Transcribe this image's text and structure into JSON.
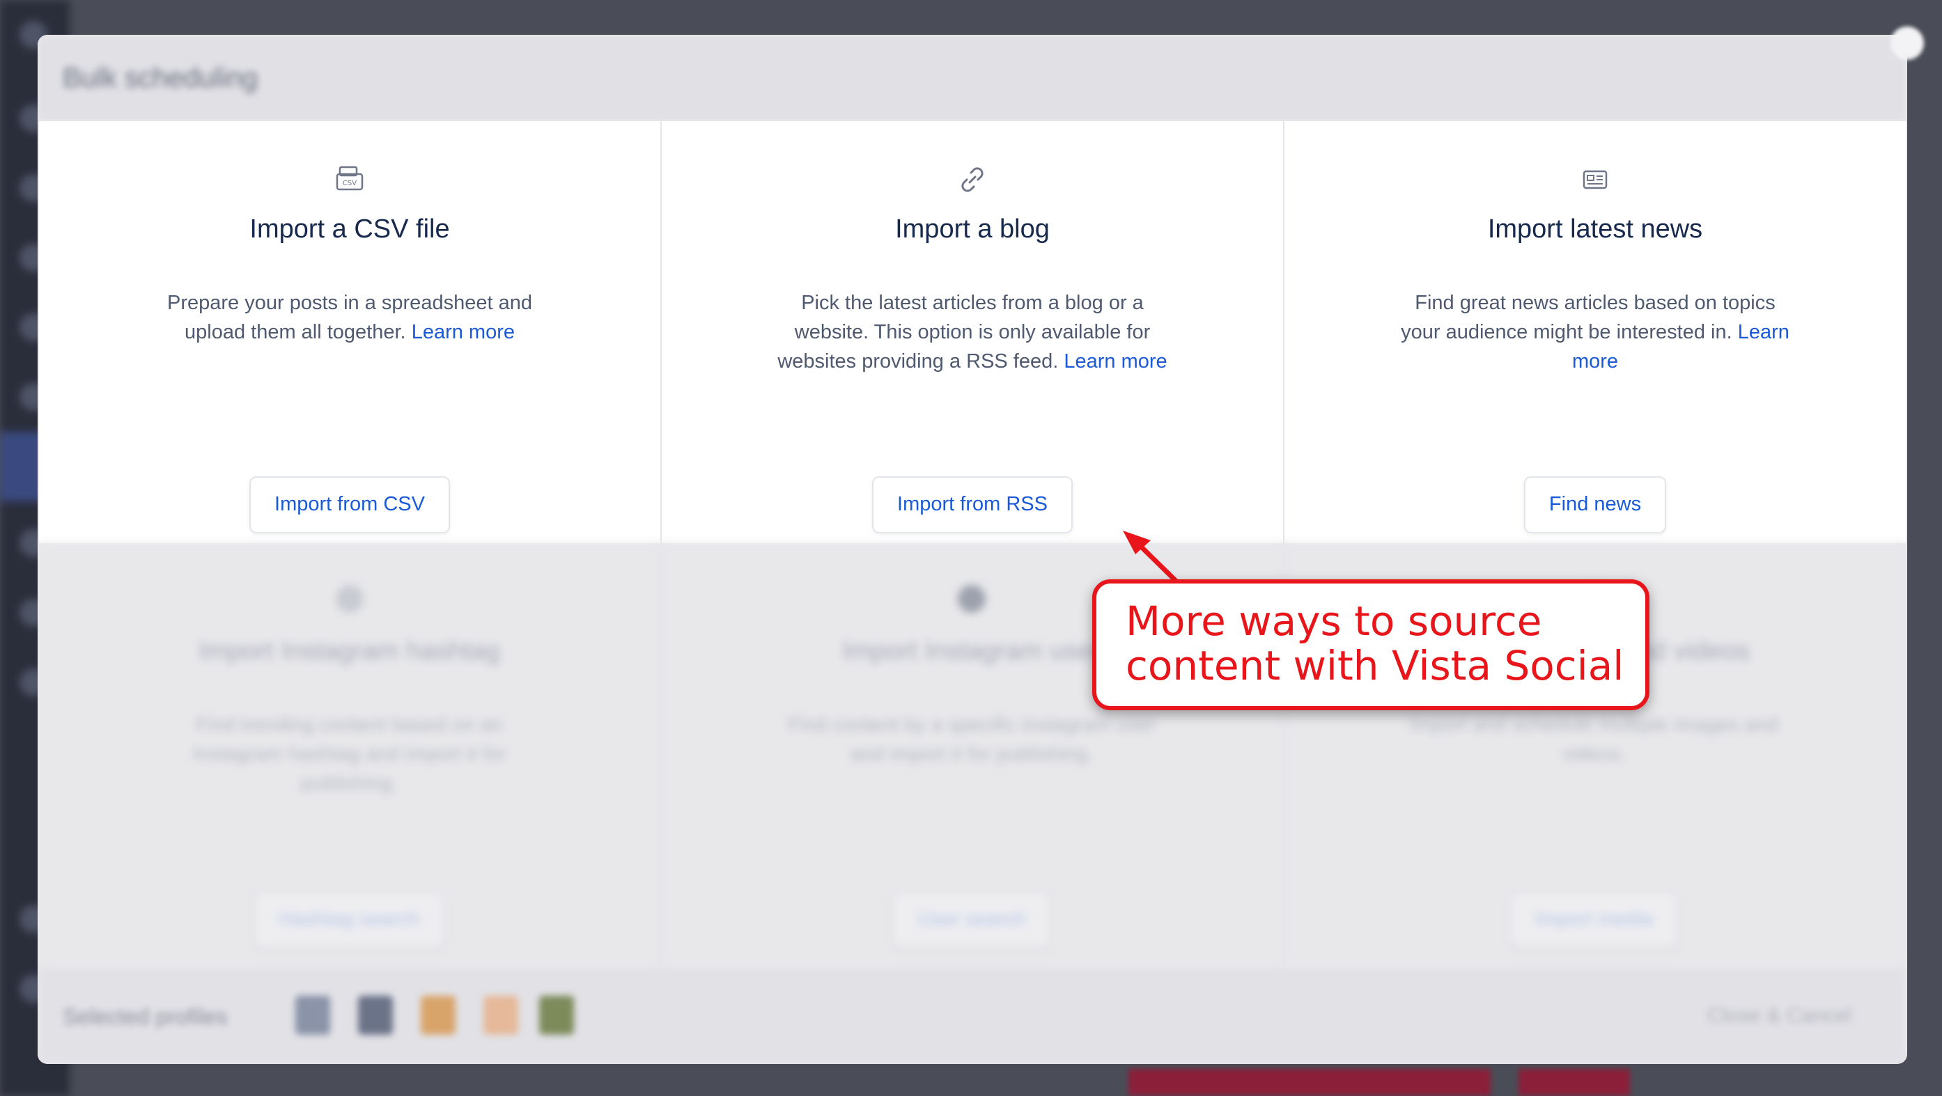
{
  "modal": {
    "title": "Bulk scheduling",
    "cards_top": [
      {
        "icon": "csv-file-icon",
        "title": "Import a CSV file",
        "description": "Prepare your posts in a spreadsheet and upload them all together.",
        "link": "Learn more",
        "button": "Import from CSV"
      },
      {
        "icon": "link-icon",
        "title": "Import a blog",
        "description": "Pick the latest articles from a blog or a website. This option is only available for websites providing a RSS feed.",
        "link": "Learn more",
        "button": "Import from RSS"
      },
      {
        "icon": "newspaper-icon",
        "title": "Import latest news",
        "description": "Find great news articles based on topics your audience might be interested in.",
        "link": "Learn more",
        "button": "Find news"
      }
    ],
    "cards_bottom": [
      {
        "title": "Import Instagram hashtag",
        "description": "Find trending content based on an Instagram hashtag and import it for publishing.",
        "button": "Hashtag search"
      },
      {
        "title": "Import Instagram user",
        "description": "Find content by a specific Instagram user and import it for publishing.",
        "button": "User search"
      },
      {
        "title": "Upload images and videos",
        "description": "Import and schedule multiple images and videos.",
        "button": "Import media"
      }
    ],
    "footer": {
      "selected_profiles_label": "Selected profiles",
      "close_button": "Close & Cancel"
    }
  },
  "callout": {
    "text": "More ways to source content with Vista Social",
    "color": "#e8161b"
  },
  "colors": {
    "link": "#1a5ad8",
    "title": "#17294d"
  }
}
